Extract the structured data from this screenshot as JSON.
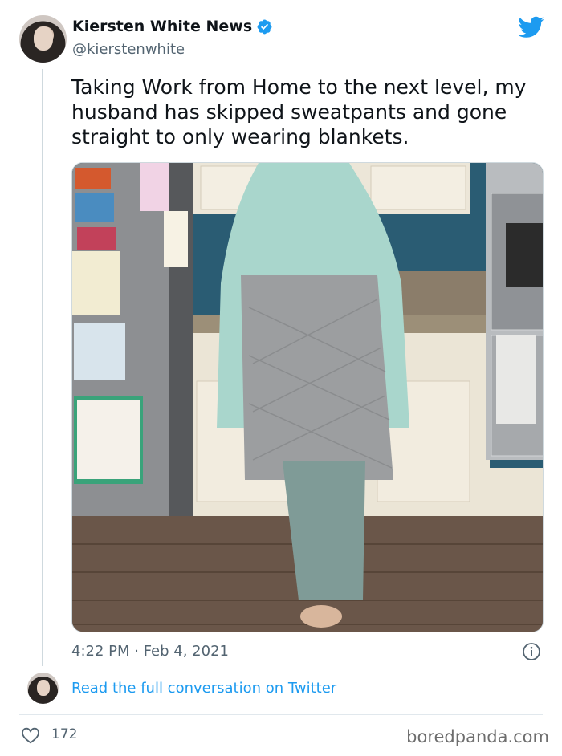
{
  "tweet": {
    "display_name": "Kiersten White News",
    "handle": "@kierstenwhite",
    "text": "Taking Work from Home to the next level, my\nhusband has skipped sweatpants and gone\nstraight to only wearing blankets.",
    "timestamp": "4:22 PM · Feb 4, 2021",
    "like_count": "172"
  },
  "conversation": {
    "link_label": "Read the full conversation on Twitter"
  },
  "footer": {
    "watermark": "boredpanda.com"
  },
  "icons": {
    "verified": "verified-badge-icon",
    "brand": "twitter-bird-icon",
    "info": "info-icon",
    "like": "heart-icon"
  },
  "colors": {
    "accent": "#1d9bf0",
    "text": "#0f1419",
    "muted": "#536471"
  }
}
